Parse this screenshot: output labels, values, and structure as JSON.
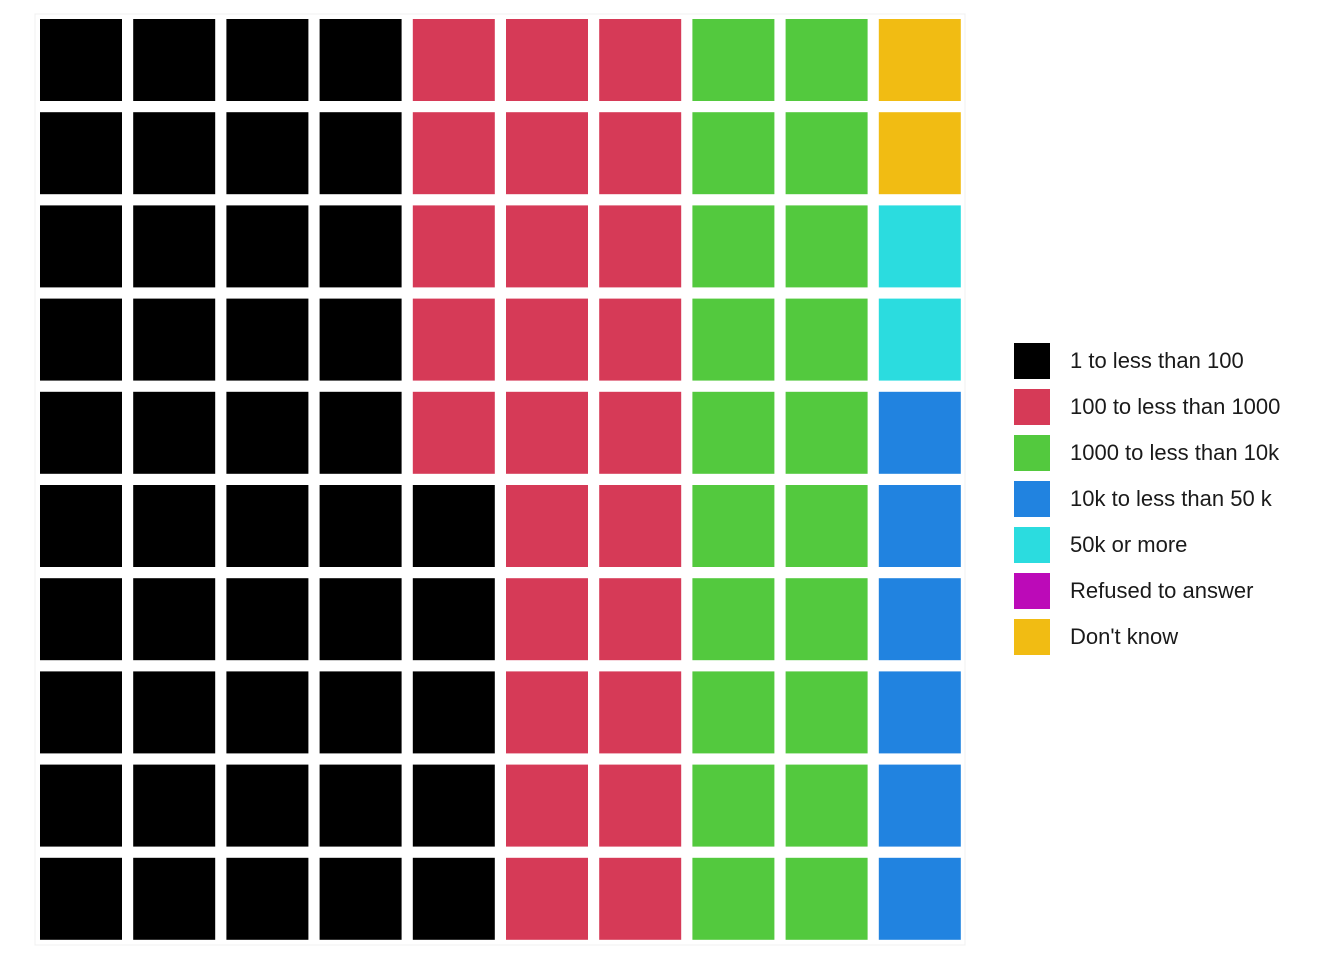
{
  "chart_data": {
    "type": "waffle",
    "grid": {
      "rows": 10,
      "cols": 10
    },
    "categories": [
      {
        "label": "1 to less than 100",
        "count": 45,
        "color": "#000000"
      },
      {
        "label": "100 to less than 1000",
        "count": 25,
        "color": "#D63A57"
      },
      {
        "label": "1000 to less than 10k",
        "count": 20,
        "color": "#53C93E"
      },
      {
        "label": "10k to less than 50 k",
        "count": 6,
        "color": "#2183E0"
      },
      {
        "label": "50k or more",
        "count": 2,
        "color": "#2BDCDF"
      },
      {
        "label": "Refused to answer",
        "count": 0,
        "color": "#BC0AB8"
      },
      {
        "label": "Don't know",
        "count": 2,
        "color": "#F1BC13"
      }
    ],
    "legend_position": "right"
  }
}
